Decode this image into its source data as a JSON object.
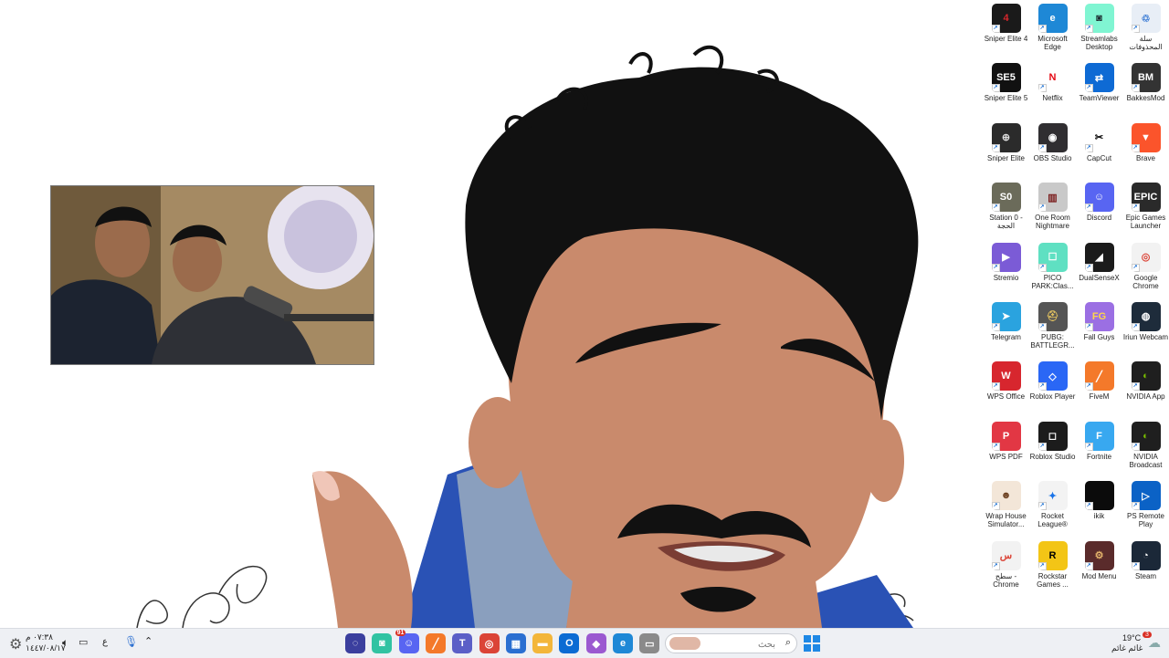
{
  "desktop": {
    "icons": [
      {
        "label": "Sniper Elite 4",
        "glyph": "4",
        "color": "#1a1a1a",
        "fg": "#d8262c",
        "icon": "sniper-elite-4-icon",
        "name": "desktop-icon-sniper-elite-4"
      },
      {
        "label": "Microsoft Edge",
        "glyph": "e",
        "color": "#1e88d6",
        "fg": "#ffffff",
        "icon": "edge-icon",
        "name": "desktop-icon-microsoft-edge"
      },
      {
        "label": "Streamlabs Desktop",
        "glyph": "◙",
        "color": "#80f5d2",
        "fg": "#1d2b30",
        "icon": "streamlabs-icon",
        "name": "desktop-icon-streamlabs"
      },
      {
        "label": "سلة المحذوفات",
        "glyph": "♲",
        "color": "#e8eef6",
        "fg": "#3a7bd5",
        "icon": "recycle-bin-icon",
        "name": "desktop-icon-recycle-bin"
      },
      {
        "label": "Sniper Elite 5",
        "glyph": "SE5",
        "color": "#111111",
        "fg": "#ffffff",
        "icon": "sniper-elite-5-icon",
        "name": "desktop-icon-sniper-elite-5"
      },
      {
        "label": "Netflix",
        "glyph": "N",
        "color": "#ffffff",
        "fg": "#e50914",
        "icon": "netflix-icon",
        "name": "desktop-icon-netflix"
      },
      {
        "label": "TeamViewer",
        "glyph": "⇄",
        "color": "#0e6ad4",
        "fg": "#ffffff",
        "icon": "teamviewer-icon",
        "name": "desktop-icon-teamviewer"
      },
      {
        "label": "BakkesMod",
        "glyph": "BM",
        "color": "#333333",
        "fg": "#ffffff",
        "icon": "bakkesmod-icon",
        "name": "desktop-icon-bakkesmod"
      },
      {
        "label": "Sniper Elite",
        "glyph": "⊕",
        "color": "#2b2b2b",
        "fg": "#dddddd",
        "icon": "sniper-elite-icon",
        "name": "desktop-icon-sniper-elite"
      },
      {
        "label": "OBS Studio",
        "glyph": "◉",
        "color": "#302e31",
        "fg": "#ffffff",
        "icon": "obs-icon",
        "name": "desktop-icon-obs-studio"
      },
      {
        "label": "CapCut",
        "glyph": "✂",
        "color": "#ffffff",
        "fg": "#000000",
        "icon": "capcut-icon",
        "name": "desktop-icon-capcut"
      },
      {
        "label": "Brave",
        "glyph": "▼",
        "color": "#fb542b",
        "fg": "#ffffff",
        "icon": "brave-icon",
        "name": "desktop-icon-brave"
      },
      {
        "label": "Station 0 - الحجة",
        "glyph": "S0",
        "color": "#6b6b5a",
        "fg": "#ffffff",
        "icon": "station-0-icon",
        "name": "desktop-icon-station-0"
      },
      {
        "label": "One Room Nightmare",
        "glyph": "▥",
        "color": "#c9c9c9",
        "fg": "#7a1c1c",
        "icon": "one-room-nightmare-icon",
        "name": "desktop-icon-one-room-nightmare"
      },
      {
        "label": "Discord",
        "glyph": "☺",
        "color": "#5865f2",
        "fg": "#ffffff",
        "icon": "discord-icon",
        "name": "desktop-icon-discord"
      },
      {
        "label": "Epic Games Launcher",
        "glyph": "EPIC",
        "color": "#2a2a2a",
        "fg": "#ffffff",
        "icon": "epic-games-icon",
        "name": "desktop-icon-epic-games"
      },
      {
        "label": "Stremio",
        "glyph": "▶",
        "color": "#7b5bd6",
        "fg": "#ffffff",
        "icon": "stremio-icon",
        "name": "desktop-icon-stremio"
      },
      {
        "label": "PICO PARK:Clas...",
        "glyph": "☐",
        "color": "#5fe0c2",
        "fg": "#ffffff",
        "icon": "pico-park-icon",
        "name": "desktop-icon-pico-park"
      },
      {
        "label": "DualSenseX",
        "glyph": "◢",
        "color": "#1b1b1b",
        "fg": "#ffffff",
        "icon": "dualsensex-icon",
        "name": "desktop-icon-dualsensex"
      },
      {
        "label": "Google Chrome",
        "glyph": "◎",
        "color": "#f2f2f2",
        "fg": "#db4437",
        "icon": "chrome-icon",
        "name": "desktop-icon-google-chrome"
      },
      {
        "label": "Telegram",
        "glyph": "➤",
        "color": "#2aa3df",
        "fg": "#ffffff",
        "icon": "telegram-icon",
        "name": "desktop-icon-telegram"
      },
      {
        "label": "PUBG: BATTLEGR...",
        "glyph": "⛑",
        "color": "#555555",
        "fg": "#e0c060",
        "icon": "pubg-icon",
        "name": "desktop-icon-pubg"
      },
      {
        "label": "Fall Guys",
        "glyph": "FG",
        "color": "#9b6fe3",
        "fg": "#ffd54a",
        "icon": "fall-guys-icon",
        "name": "desktop-icon-fall-guys"
      },
      {
        "label": "Iriun Webcam",
        "glyph": "◍",
        "color": "#1e2c3b",
        "fg": "#ffffff",
        "icon": "iriun-webcam-icon",
        "name": "desktop-icon-iriun-webcam"
      },
      {
        "label": "WPS Office",
        "glyph": "W",
        "color": "#d7262e",
        "fg": "#ffffff",
        "icon": "wps-office-icon",
        "name": "desktop-icon-wps-office"
      },
      {
        "label": "Roblox Player",
        "glyph": "◇",
        "color": "#2a67f5",
        "fg": "#ffffff",
        "icon": "roblox-player-icon",
        "name": "desktop-icon-roblox-player"
      },
      {
        "label": "FiveM",
        "glyph": "╱",
        "color": "#f4792a",
        "fg": "#ffffff",
        "icon": "fivem-icon",
        "name": "desktop-icon-fivem"
      },
      {
        "label": "NVIDIA App",
        "glyph": "◐",
        "color": "#1f1f1f",
        "fg": "#76b900",
        "icon": "nvidia-app-icon",
        "name": "desktop-icon-nvidia-app"
      },
      {
        "label": "WPS PDF",
        "glyph": "P",
        "color": "#e23744",
        "fg": "#ffffff",
        "icon": "wps-pdf-icon",
        "name": "desktop-icon-wps-pdf"
      },
      {
        "label": "Roblox Studio",
        "glyph": "◻",
        "color": "#1c1c1c",
        "fg": "#ffffff",
        "icon": "roblox-studio-icon",
        "name": "desktop-icon-roblox-studio"
      },
      {
        "label": "Fortnite",
        "glyph": "F",
        "color": "#38a8f0",
        "fg": "#ffffff",
        "icon": "fortnite-icon",
        "name": "desktop-icon-fortnite"
      },
      {
        "label": "NVIDIA Broadcast",
        "glyph": "◐",
        "color": "#1f1f1f",
        "fg": "#76b900",
        "icon": "nvidia-broadcast-icon",
        "name": "desktop-icon-nvidia-broadcast"
      },
      {
        "label": "Wrap House Simulator...",
        "glyph": "☻",
        "color": "#f3e6d8",
        "fg": "#6b3f1f",
        "icon": "wrap-house-icon",
        "name": "desktop-icon-wrap-house"
      },
      {
        "label": "Rocket League®",
        "glyph": "✦",
        "color": "#f3f3f3",
        "fg": "#1a73e8",
        "icon": "rocket-league-icon",
        "name": "desktop-icon-rocket-league"
      },
      {
        "label": "ikik",
        "glyph": "",
        "color": "#0b0b0b",
        "fg": "#ffffff",
        "icon": "ikik-icon",
        "name": "desktop-icon-ikik"
      },
      {
        "label": "PS Remote Play",
        "glyph": "▷",
        "color": "#0b62c6",
        "fg": "#ffffff",
        "icon": "ps-remote-play-icon",
        "name": "desktop-icon-ps-remote-play"
      },
      {
        "label": "سطح - Chrome",
        "glyph": "س",
        "color": "#f2f2f2",
        "fg": "#db4437",
        "icon": "chrome-shortcut-icon",
        "name": "desktop-icon-chrome-shortcut"
      },
      {
        "label": "Rockstar Games ...",
        "glyph": "R",
        "color": "#f3c516",
        "fg": "#000000",
        "icon": "rockstar-icon",
        "name": "desktop-icon-rockstar"
      },
      {
        "label": "Mod Menu",
        "glyph": "⚙",
        "color": "#5a2b2b",
        "fg": "#e2b26a",
        "icon": "mod-menu-icon",
        "name": "desktop-icon-mod-menu"
      },
      {
        "label": "Steam",
        "glyph": "◔",
        "color": "#1b2838",
        "fg": "#ffffff",
        "icon": "steam-icon",
        "name": "desktop-icon-steam"
      }
    ]
  },
  "taskbar": {
    "search_placeholder": "بحث",
    "apps": [
      {
        "icon": "copilot-icon",
        "name": "taskbar-copilot",
        "glyph": "◌",
        "color": "#3b3f9e"
      },
      {
        "icon": "streamlabs-icon",
        "name": "taskbar-streamlabs",
        "glyph": "◙",
        "color": "#31c3a2"
      },
      {
        "icon": "discord-icon",
        "name": "taskbar-discord",
        "glyph": "☺",
        "color": "#5865f2"
      },
      {
        "icon": "fivem-icon",
        "name": "taskbar-fivem",
        "glyph": "╱",
        "color": "#f4792a"
      },
      {
        "icon": "teams-icon",
        "name": "taskbar-teams",
        "glyph": "T",
        "color": "#5b5fc7"
      },
      {
        "icon": "chrome-icon",
        "name": "taskbar-chrome",
        "glyph": "◎",
        "color": "#db4437"
      },
      {
        "icon": "store-icon",
        "name": "taskbar-store",
        "glyph": "▦",
        "color": "#2b6fd1"
      },
      {
        "icon": "folder-icon",
        "name": "taskbar-file-explorer",
        "glyph": "▬",
        "color": "#f3b63a"
      },
      {
        "icon": "outlook-icon",
        "name": "taskbar-outlook",
        "glyph": "O",
        "color": "#0b6bd3"
      },
      {
        "icon": "m365-icon",
        "name": "taskbar-m365",
        "glyph": "◆",
        "color": "#9b59d0"
      },
      {
        "icon": "edge-icon",
        "name": "taskbar-edge",
        "glyph": "e",
        "color": "#1e88d6"
      },
      {
        "icon": "app-window-icon",
        "name": "taskbar-app",
        "glyph": "▭",
        "color": "#8a8a8a"
      }
    ],
    "discord_badge": "91",
    "weather_badge": "3",
    "time": "٠٧:٣٨ م",
    "date": "١٤٤٧/٠٨/١٧",
    "lang": "ع",
    "weather_temp": "19°C",
    "weather_desc": "غائم غائم"
  }
}
